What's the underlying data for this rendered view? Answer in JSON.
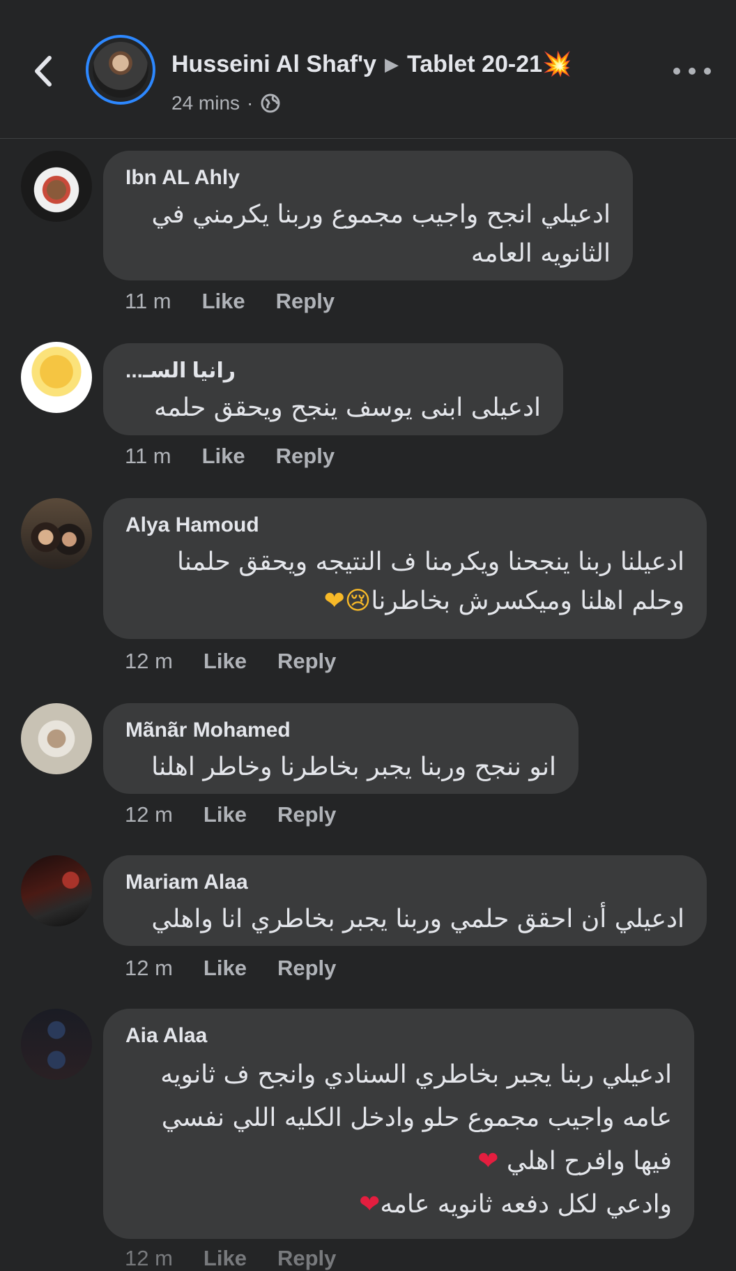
{
  "header": {
    "author": "Husseini Al Shaf'y",
    "arrow": "▶",
    "group": "Tablet 20-21",
    "group_emoji": "💥",
    "time": "24 mins",
    "separator": "·"
  },
  "comments": [
    {
      "name": "Ibn AL Ahly",
      "lines": [
        "ادعيلي انجح واجيب مجموع وربنا يكرمني في",
        "الثانويه العامه"
      ],
      "time": "11 m",
      "like": "Like",
      "reply": "Reply"
    },
    {
      "name": "رانيا السـ...",
      "lines": [
        "ادعيلى ابنى يوسف ينجح ويحقق حلمه"
      ],
      "time": "11 m",
      "like": "Like",
      "reply": "Reply"
    },
    {
      "name": "Alya Hamoud",
      "lines": [
        "ادعيلنا ربنا ينجحنا ويكرمنا ف النتيجه ويحقق حلمنا",
        "وحلم اهلنا وميكسرش بخاطرنا"
      ],
      "emojis": "😢❤",
      "time": "12 m",
      "like": "Like",
      "reply": "Reply"
    },
    {
      "name": "Mãnãr Mohamed",
      "lines": [
        "انو ننجح وربنا يجبر بخاطرنا وخاطر اهلنا"
      ],
      "time": "12 m",
      "like": "Like",
      "reply": "Reply"
    },
    {
      "name": "Mariam Alaa",
      "lines": [
        "ادعيلي أن احقق حلمي وربنا يجبر بخاطري انا واهلي"
      ],
      "time": "12 m",
      "like": "Like",
      "reply": "Reply"
    },
    {
      "name": "Aia Alaa",
      "lines": [
        "ادعيلي ربنا يجبر بخاطري السنادي وانجح ف ثانويه",
        "عامه واجيب مجموع حلو وادخل الكليه اللي نفسي",
        "فيها وافرح اهلي",
        "وادعي لكل دفعه ثانويه عامه"
      ],
      "line_emojis": [
        "",
        "",
        "❤",
        "❤"
      ],
      "time": "12 m",
      "like": "Like",
      "reply": "Reply"
    }
  ],
  "colors": {
    "background": "#242526",
    "bubble": "#3a3b3c",
    "accent": "#2d88ff",
    "secondary_text": "#b0b3b8"
  },
  "icons": [
    "chevron-left-icon",
    "globe-icon",
    "more-dots-icon"
  ]
}
